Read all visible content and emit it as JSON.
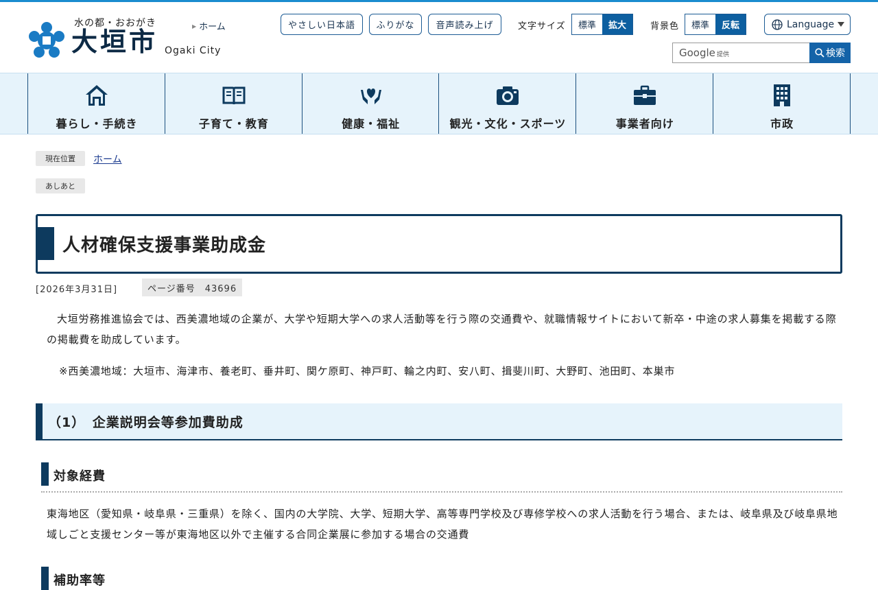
{
  "header": {
    "logo_sub": "水の都・おおがき",
    "logo_main": "大垣市",
    "logo_en": "Ogaki City",
    "home_link": "ホーム",
    "easy_japanese": "やさしい日本語",
    "furigana": "ふりがな",
    "read_aloud": "音声読み上げ",
    "text_size_label": "文字サイズ",
    "text_size_standard": "標準",
    "text_size_large": "拡大",
    "bg_label": "背景色",
    "bg_standard": "標準",
    "bg_invert": "反転",
    "language": "Language",
    "search_google": "Google",
    "search_provided": "提供",
    "search_placeholder": "",
    "search_button": "検索"
  },
  "nav": {
    "items": [
      {
        "label": "暮らし・手続き",
        "icon": "home-icon"
      },
      {
        "label": "子育て・教育",
        "icon": "book-icon"
      },
      {
        "label": "健康・福祉",
        "icon": "hands-heart-icon"
      },
      {
        "label": "観光・文化・スポーツ",
        "icon": "camera-icon"
      },
      {
        "label": "事業者向け",
        "icon": "briefcase-icon"
      },
      {
        "label": "市政",
        "icon": "building-icon"
      }
    ]
  },
  "breadcrumb": {
    "current_label": "現在位置",
    "home": "ホーム",
    "history_label": "あしあと"
  },
  "article": {
    "title": "人材確保支援事業助成金",
    "date": "[2026年3月31日]",
    "page_number": "ページ番号　43696",
    "intro": "大垣労務推進協会では、西美濃地域の企業が、大学や短期大学への求人活動等を行う際の交通費や、就職情報サイトにおいて新卒・中途の求人募集を掲載する際の掲載費を助成しています。",
    "note": "※西美濃地域：大垣市、海津市、養老町、垂井町、関ケ原町、神戸町、輪之内町、安八町、揖斐川町、大野町、池田町、本巣市",
    "section1_heading": "（1）　企業説明会等参加費助成",
    "sub1_heading": "対象経費",
    "sub1_body": "東海地区（愛知県・岐阜県・三重県）を除く、国内の大学院、大学、短期大学、高等専門学校及び専修学校への求人活動を行う場合、または、岐阜県及び岐阜県地域しごと支援センター等が東海地区以外で主催する合同企業展に参加する場合の交通費",
    "sub2_heading": "補助率等"
  },
  "colors": {
    "accent": "#0d3a5e",
    "link": "#1a3a8f",
    "nav_bg": "#e6f3fb",
    "button_blue": "#1463a8",
    "top_line": "#1a8ccf"
  }
}
